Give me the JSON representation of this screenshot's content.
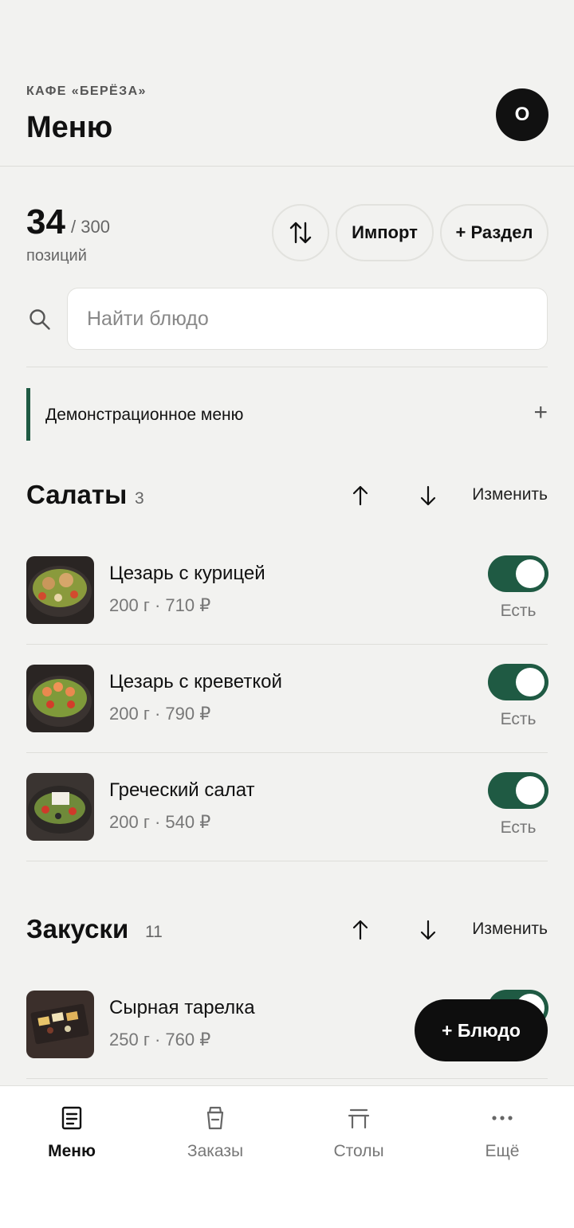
{
  "header": {
    "cafe_name": "КАФЕ «БЕРЁЗА»",
    "title": "Меню",
    "avatar_letter": "О"
  },
  "stats": {
    "count": "34",
    "total": "/ 300",
    "label": "позиций"
  },
  "toolbar": {
    "import_label": "Импорт",
    "add_section_label": "+ Раздел"
  },
  "search": {
    "placeholder": "Найти блюдо"
  },
  "menu_group": {
    "label": "Демонстрационное меню",
    "add": "+"
  },
  "categories": [
    {
      "title": "Салаты",
      "count": "3",
      "edit_label": "Изменить",
      "items": [
        {
          "name": "Цезарь с курицей",
          "meta": "200 г · 710 ₽",
          "status": "Есть"
        },
        {
          "name": "Цезарь с креветкой",
          "meta": "200 г · 790 ₽",
          "status": "Есть"
        },
        {
          "name": "Греческий салат",
          "meta": "200 г · 540 ₽",
          "status": "Есть"
        }
      ]
    },
    {
      "title": "Закуски",
      "count": "11",
      "edit_label": "Изменить",
      "items": [
        {
          "name": "Сырная тарелка",
          "meta": "250 г · 760 ₽"
        }
      ]
    }
  ],
  "fab": {
    "label": "+ Блюдо"
  },
  "tabs": [
    {
      "label": "Меню",
      "icon": "menu-doc-icon",
      "active": true
    },
    {
      "label": "Заказы",
      "icon": "bag-icon"
    },
    {
      "label": "Столы",
      "icon": "table-icon"
    },
    {
      "label": "Ещё",
      "icon": "more-dots-icon"
    }
  ],
  "colors": {
    "accent": "#1f5a43",
    "background": "#f2f2f0",
    "dark": "#0e0e0e"
  }
}
